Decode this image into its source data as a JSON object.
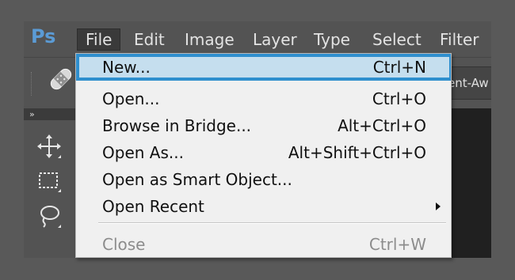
{
  "app": {
    "logo": "Ps"
  },
  "menubar": {
    "items": [
      {
        "label": "File",
        "active": true
      },
      {
        "label": "Edit"
      },
      {
        "label": "Image"
      },
      {
        "label": "Layer"
      },
      {
        "label": "Type"
      },
      {
        "label": "Select"
      },
      {
        "label": "Filter"
      }
    ]
  },
  "options_bar": {
    "tool_icon": "bandaid-healing-icon",
    "partial_field_text": "ent-Aw"
  },
  "toolbar": {
    "header": "»",
    "tools": [
      {
        "name": "move-tool",
        "icon": "move-icon"
      },
      {
        "name": "marquee-tool",
        "icon": "rect-marquee-icon"
      },
      {
        "name": "lasso-tool",
        "icon": "lasso-icon"
      }
    ]
  },
  "file_menu": {
    "items": [
      {
        "label": "New...",
        "shortcut": "Ctrl+N",
        "highlighted": true
      },
      {
        "label": "Open...",
        "shortcut": "Ctrl+O"
      },
      {
        "label": "Browse in Bridge...",
        "shortcut": "Alt+Ctrl+O"
      },
      {
        "label": "Open As...",
        "shortcut": "Alt+Shift+Ctrl+O"
      },
      {
        "label": "Open as Smart Object...",
        "shortcut": ""
      },
      {
        "label": "Open Recent",
        "shortcut": "",
        "submenu": true
      },
      {
        "label": "Close",
        "shortcut": "Ctrl+W",
        "disabled": true
      }
    ]
  },
  "colors": {
    "highlight_border": "#2f8fce",
    "highlight_fill": "#c5deee",
    "ps_blue": "#5b9bd5",
    "menubar_bg": "#535353"
  }
}
